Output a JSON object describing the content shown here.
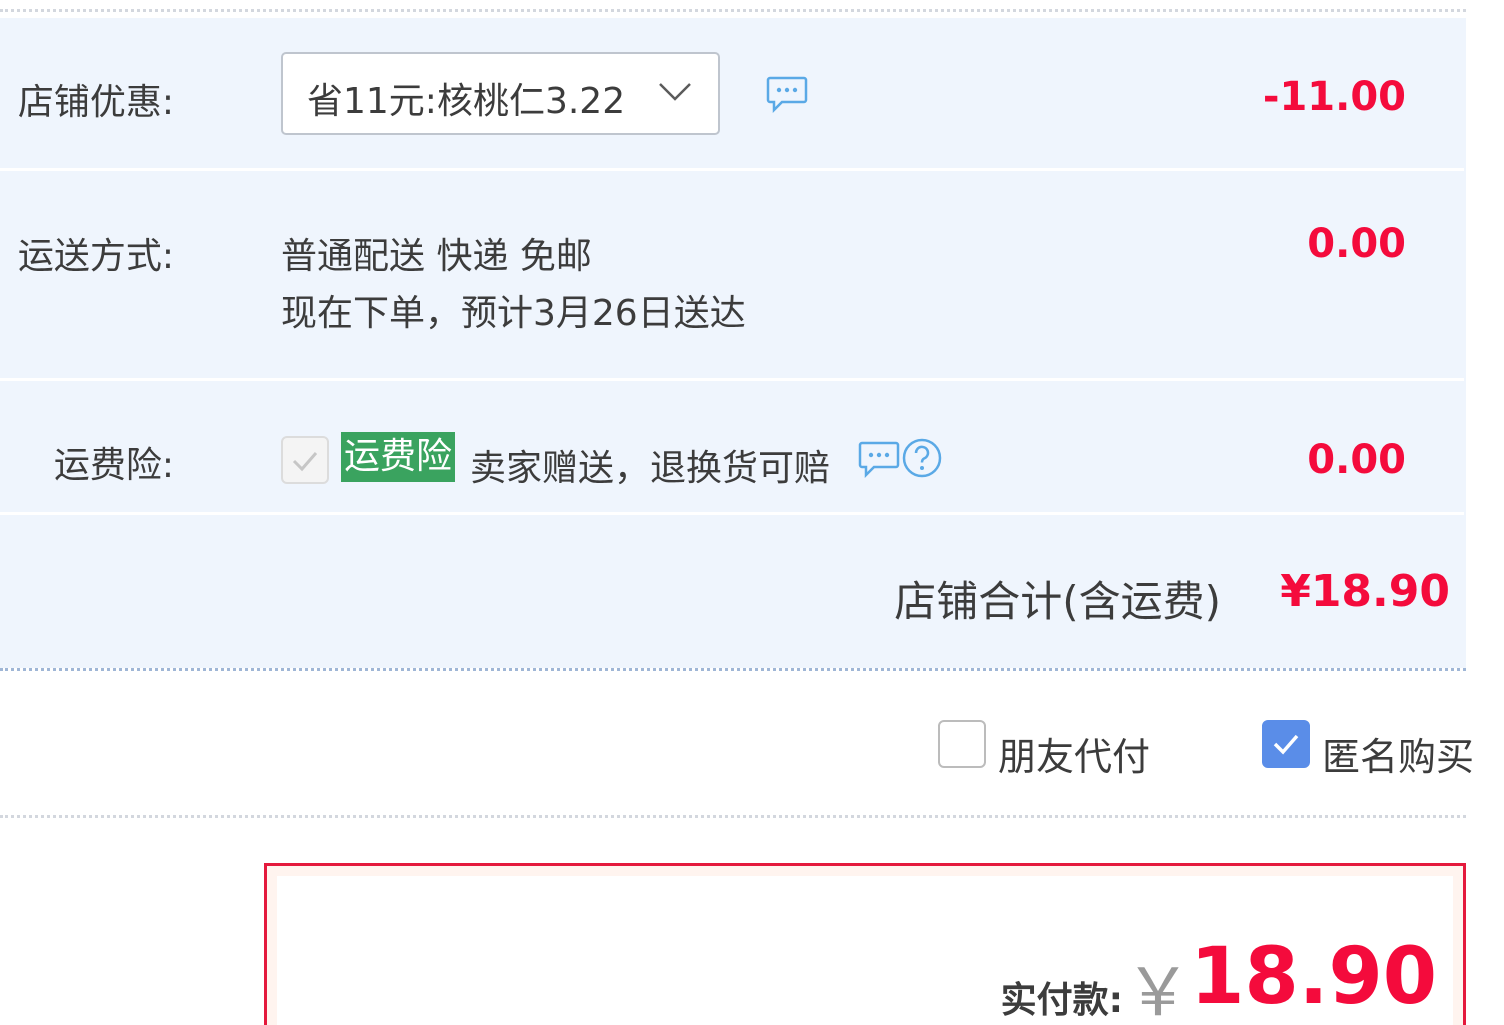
{
  "shop_coupon": {
    "label": "店铺优惠:",
    "selected": "省11元:核桃仁3.22",
    "amount": "-11.00"
  },
  "shipping": {
    "label": "运送方式:",
    "method": "普通配送 快递 免邮",
    "eta": "现在下单，预计3月26日送达",
    "amount": "0.00"
  },
  "insurance": {
    "label": "运费险:",
    "tag": "运费险",
    "description": "卖家赠送，退换货可赔",
    "checked": true,
    "amount": "0.00"
  },
  "shop_total": {
    "label": "店铺合计(含运费)",
    "value": "¥18.90"
  },
  "options": {
    "friend_pay": {
      "label": "朋友代付",
      "checked": false
    },
    "anonymous": {
      "label": "匿名购买",
      "checked": true
    }
  },
  "payment": {
    "label": "实付款:",
    "currency": "￥",
    "amount": "18.90"
  },
  "colors": {
    "price_red": "#f40b3c",
    "panel_bg": "#eff5fd",
    "insurance_tag_green": "#3aa35f",
    "checkbox_blue": "#5a8de8",
    "icon_blue": "#5aa9e6"
  }
}
